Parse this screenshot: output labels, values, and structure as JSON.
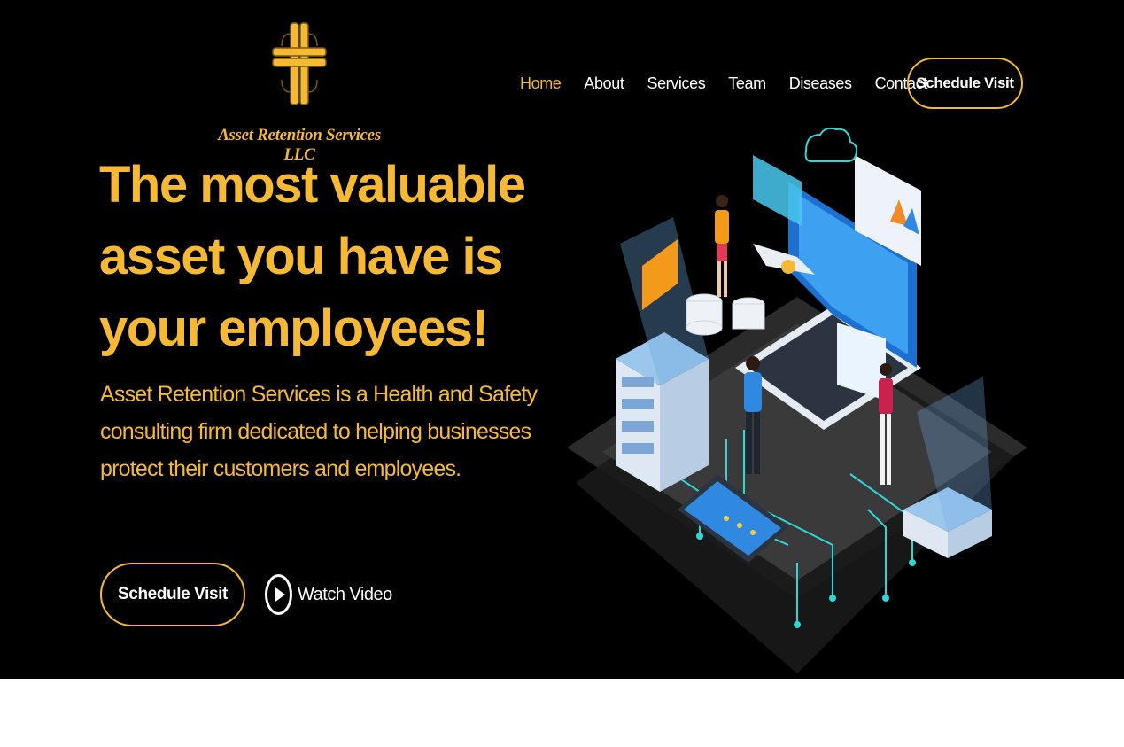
{
  "brand": {
    "name": "Asset Retention Services LLC"
  },
  "nav": {
    "items": [
      {
        "label": "Home",
        "active": true
      },
      {
        "label": "About"
      },
      {
        "label": "Services"
      },
      {
        "label": "Team"
      },
      {
        "label": "Diseases"
      },
      {
        "label": "Contact"
      }
    ],
    "cta_label": "Schedule Visit"
  },
  "hero": {
    "headline": "The most valuable asset you have is your employees!",
    "subtext": "Asset Retention Services is a Health and Safety consulting firm dedicated to helping businesses protect their customers and employees.",
    "primary_cta": "Schedule Visit",
    "video_cta": "Watch Video"
  },
  "colors": {
    "background": "#000000",
    "accent": "#f5b933",
    "text": "#ffffff",
    "below_fold": "#ffffff"
  },
  "icons": [
    "cross-logo-icon",
    "play-icon",
    "it-network-illustration"
  ]
}
